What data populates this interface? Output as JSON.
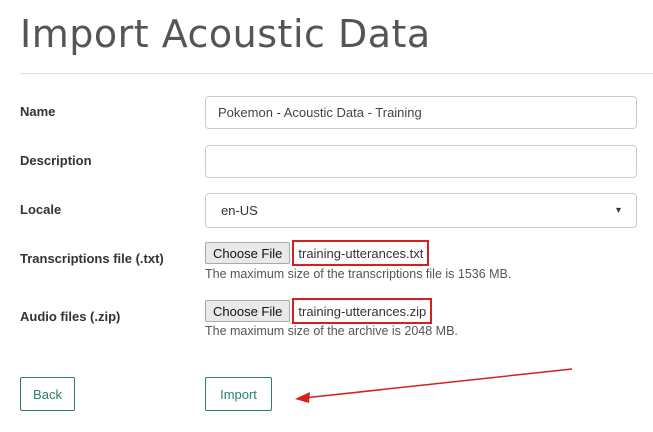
{
  "page": {
    "title": "Import Acoustic Data"
  },
  "form": {
    "name": {
      "label": "Name",
      "value": "Pokemon - Acoustic Data - Training"
    },
    "description": {
      "label": "Description",
      "value": ""
    },
    "locale": {
      "label": "Locale",
      "value": "en-US",
      "caret": "▾"
    },
    "transcriptions": {
      "label": "Transcriptions file (.txt)",
      "button_label": "Choose File",
      "file_name": "training-utterances.txt",
      "help": "The maximum size of the transcriptions file is 1536 MB."
    },
    "audio": {
      "label": "Audio files (.zip)",
      "button_label": "Choose File",
      "file_name": "training-utterances.zip",
      "help": "The maximum size of the archive is 2048 MB."
    }
  },
  "actions": {
    "back_label": "Back",
    "import_label": "Import"
  },
  "colors": {
    "accent": "#2a7d6f",
    "annotation": "#d62020"
  }
}
